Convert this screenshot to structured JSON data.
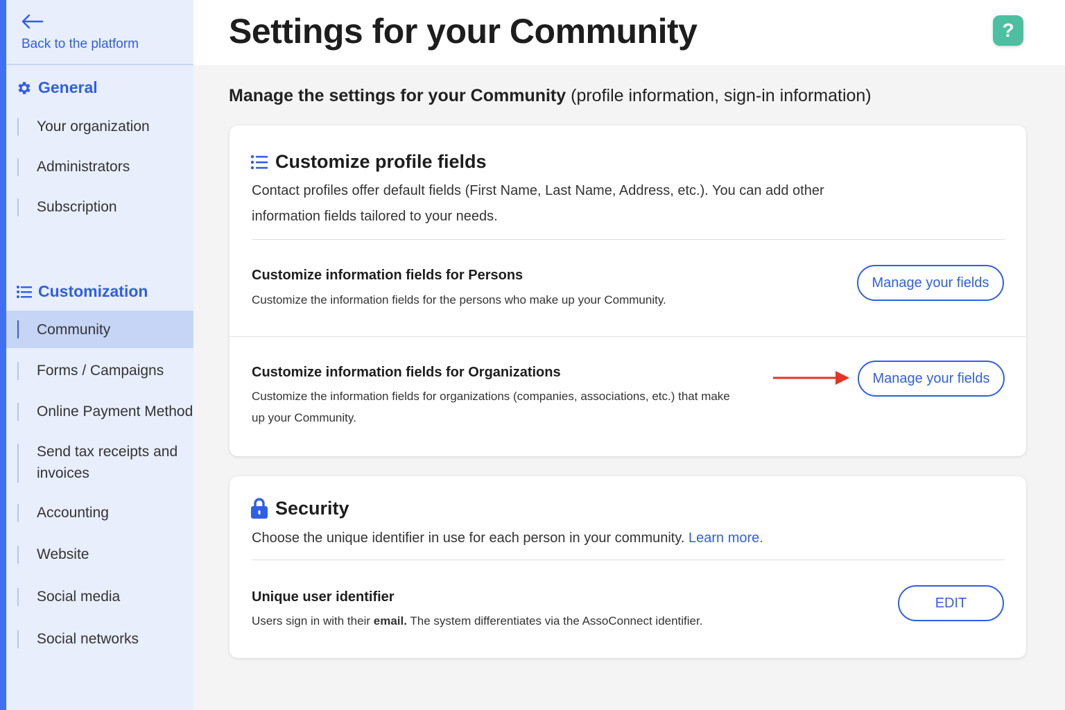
{
  "sidebar": {
    "back_label": "Back to the platform",
    "general": {
      "title": "General",
      "items": [
        "Your organization",
        "Administrators",
        "Subscription"
      ]
    },
    "customization": {
      "title": "Customization",
      "items": [
        "Community",
        "Forms / Campaigns",
        "Online Payment Method",
        "Send tax receipts and invoices",
        "Accounting",
        "Website",
        "Social media",
        "Social networks"
      ],
      "active": "Community"
    }
  },
  "header": {
    "title": "Settings for your Community",
    "help_label": "?"
  },
  "subtitle": {
    "bold": "Manage the settings for your Community",
    "rest": "(profile information, sign-in information)"
  },
  "profile_card": {
    "title": "Customize profile fields",
    "description": "Contact profiles offer default fields (First Name, Last Name, Address, etc.). You can add other information fields tailored to your needs.",
    "persons": {
      "title": "Customize information fields for Persons",
      "description": "Customize the information fields for the persons who make up your Community.",
      "button": "Manage your fields"
    },
    "organizations": {
      "title": "Customize information fields for Organizations",
      "description": "Customize the information fields for organizations (companies, associations, etc.) that make up your Community.",
      "button": "Manage your fields"
    }
  },
  "security_card": {
    "title": "Security",
    "description": "Choose the unique identifier in use for each person in your community.",
    "learn_more": "Learn more.",
    "identifier": {
      "title": "Unique user identifier",
      "desc_pre": "Users sign in with their",
      "desc_bold": "email.",
      "desc_post": "The system differentiates via the AssoConnect identifier.",
      "button": "EDIT"
    }
  },
  "colors": {
    "accent": "#2f5ee6",
    "sidebar_bg": "#e8eefc",
    "active_bg": "#c6d4f6",
    "help": "#4cc0a0",
    "annotation_arrow": "#e53423"
  }
}
